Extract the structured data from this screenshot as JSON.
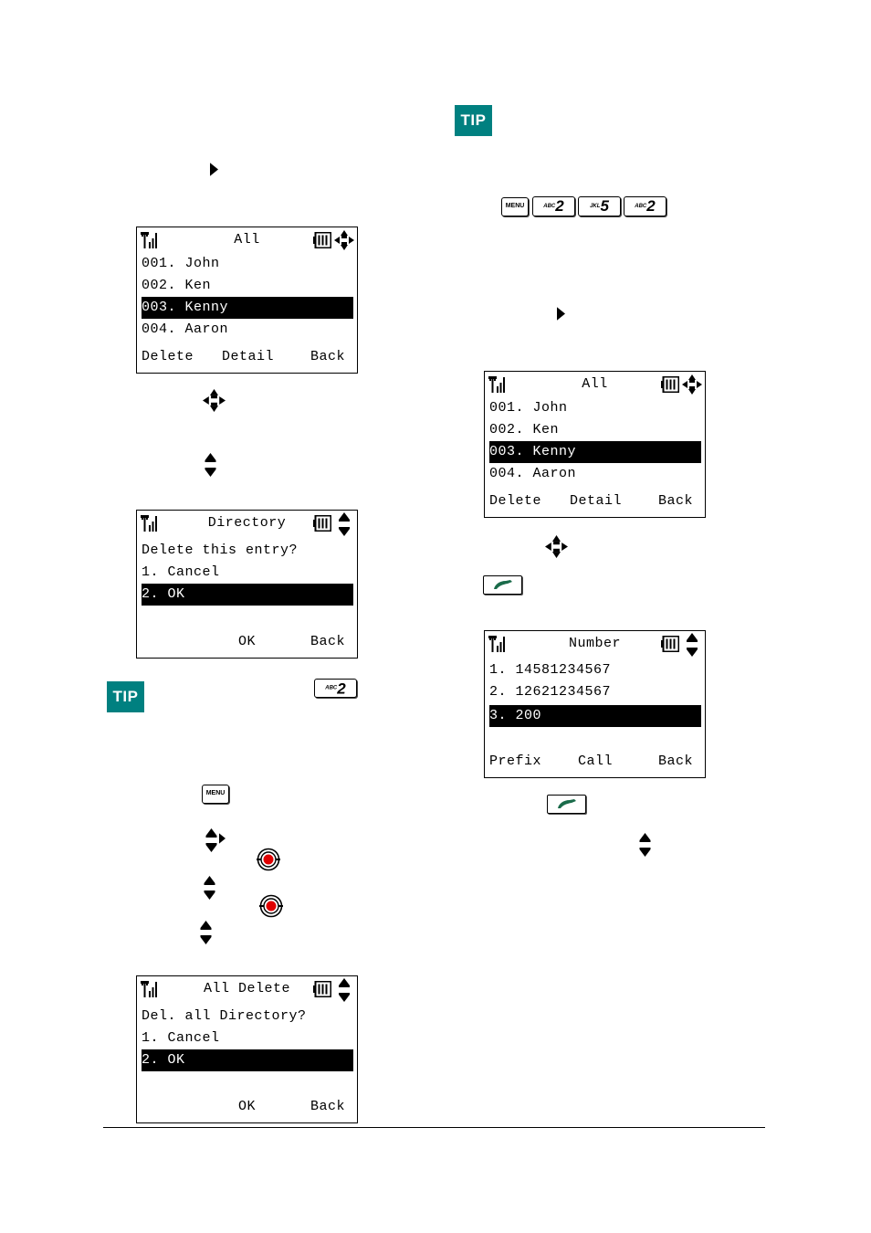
{
  "colors": {
    "tip_bg": "#008080",
    "call_green": "#1a6b4a",
    "ok_red": "#e00000"
  },
  "tips": [
    {
      "label": "TIP"
    },
    {
      "label": "TIP"
    }
  ],
  "keys": {
    "menu": "MENU",
    "abc2": {
      "letters": "ABC",
      "digit": "2"
    },
    "jkl5": {
      "letters": "JKL",
      "digit": "5"
    }
  },
  "screens": {
    "directory_list_left": {
      "title": "All",
      "rows": [
        "001. John",
        "002. Ken",
        "003. Kenny",
        "004. Aaron"
      ],
      "selected_index": 2,
      "softkeys": {
        "left": "Delete",
        "center": "Detail",
        "right": "Back"
      }
    },
    "delete_entry": {
      "title": "Directory",
      "rows": [
        "Delete this entry?",
        "1. Cancel",
        "2. OK"
      ],
      "selected_index": 2,
      "softkeys": {
        "left": "",
        "center": "OK",
        "right": "Back"
      }
    },
    "delete_all": {
      "title": "All Delete",
      "rows": [
        "Del. all Directory?",
        "1. Cancel",
        "2. OK"
      ],
      "selected_index": 2,
      "softkeys": {
        "left": "",
        "center": "OK",
        "right": "Back"
      }
    },
    "directory_list_right": {
      "title": "All",
      "rows": [
        "001. John",
        "002. Ken",
        "003. Kenny",
        "004. Aaron"
      ],
      "selected_index": 2,
      "softkeys": {
        "left": "Delete",
        "center": "Detail",
        "right": "Back"
      }
    },
    "number_select": {
      "title": "Number",
      "rows": [
        "1. 14581234567",
        "2. 12621234567",
        "3. 200"
      ],
      "selected_index": 2,
      "softkeys": {
        "left": "Prefix",
        "center": "Call",
        "right": "Back"
      }
    }
  },
  "icons": {
    "signal": "signal-strength-icon",
    "battery": "battery-icon",
    "nav_four_way": "four-way-nav-icon",
    "nav_up_down": "up-down-nav-icon",
    "right_arrow": "right-arrow-icon",
    "ok_button": "ok-button-icon",
    "call_key": "call-handset-icon"
  }
}
